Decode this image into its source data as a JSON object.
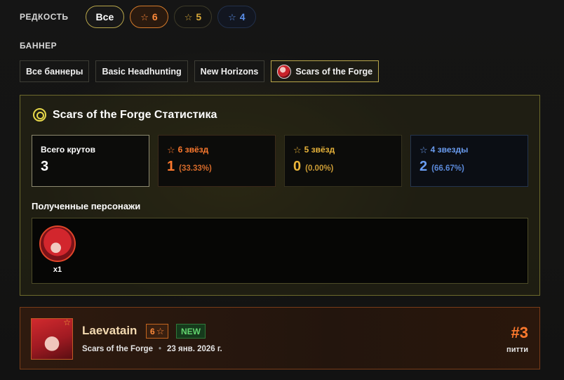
{
  "filters": {
    "rarity_label": "РЕДКОСТЬ",
    "rarity_options": [
      {
        "label": "Все"
      },
      {
        "label": "6"
      },
      {
        "label": "5"
      },
      {
        "label": "4"
      }
    ],
    "banner_label": "БАННЕР",
    "banner_options": [
      {
        "label": "Все баннеры"
      },
      {
        "label": "Basic Headhunting"
      },
      {
        "label": "New Horizons"
      },
      {
        "label": "Scars of the Forge"
      }
    ],
    "active_banner": "Scars of the Forge"
  },
  "stats": {
    "title": "Scars of the Forge Статистика",
    "cards": [
      {
        "label": "Всего крутов",
        "value": "3",
        "percent": ""
      },
      {
        "label": "6 звёзд",
        "value": "1",
        "percent": "(33.33%)"
      },
      {
        "label": "5 звёзд",
        "value": "0",
        "percent": "(0.00%)"
      },
      {
        "label": "4 звезды",
        "value": "2",
        "percent": "(66.67%)"
      }
    ],
    "obtained_label": "Полученные персонажи",
    "obtained": [
      {
        "count": "x1"
      }
    ]
  },
  "pull": {
    "name": "Laevatain",
    "rarity": "6",
    "new_badge": "NEW",
    "banner": "Scars of the Forge",
    "separator": "•",
    "date": "23 янв. 2026 г.",
    "pity_number": "#3",
    "pity_label": "питти"
  },
  "colors": {
    "accent_gold": "#b8a64a",
    "six_star": "#ff7a2e",
    "five_star": "#e9b43a",
    "four_star": "#6a9cf0",
    "new_green": "#62d46e"
  }
}
